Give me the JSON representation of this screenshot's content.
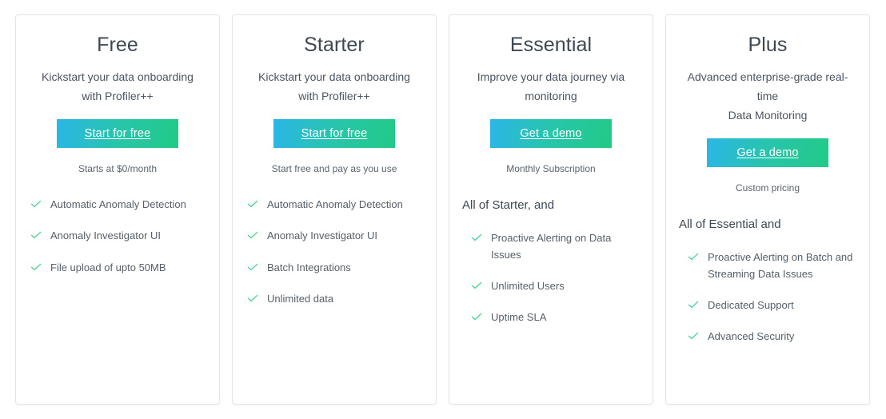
{
  "accent": {
    "gradient_start": "#2ab6e8",
    "gradient_end": "#22ca86",
    "check_color": "#3ecf8e",
    "title_color": "#3d4852",
    "body_color": "#56606a",
    "card_border": "#e2e5e8"
  },
  "plans": [
    {
      "name": "Free",
      "subtitle": "Kickstart your data onboarding with Profiler++",
      "cta_label": "Start for free",
      "price": "Starts at $0/month",
      "features_heading": "",
      "features": [
        "Automatic Anomaly Detection",
        "Anomaly Investigator UI",
        "File upload of upto 50MB"
      ]
    },
    {
      "name": "Starter",
      "subtitle": "Kickstart your data onboarding with Profiler++",
      "cta_label": "Start for free",
      "price": "Start free and pay as you use",
      "features_heading": "",
      "features": [
        "Automatic Anomaly Detection",
        "Anomaly Investigator UI",
        "Batch Integrations",
        "Unlimited data"
      ]
    },
    {
      "name": "Essential",
      "subtitle": "Improve your data journey via monitoring",
      "cta_label": "Get a demo",
      "price": "Monthly Subscription",
      "features_heading": "All of Starter, and",
      "features": [
        "Proactive Alerting on Data Issues",
        "Unlimited Users",
        "Uptime SLA"
      ]
    },
    {
      "name": "Plus",
      "subtitle": "Advanced enterprise-grade real-time\nData Monitoring",
      "cta_label": "Get a demo",
      "price": "Custom pricing",
      "features_heading": "All of Essential and",
      "features": [
        "Proactive Alerting on Batch and Streaming Data Issues",
        "Dedicated Support",
        "Advanced Security"
      ]
    }
  ]
}
